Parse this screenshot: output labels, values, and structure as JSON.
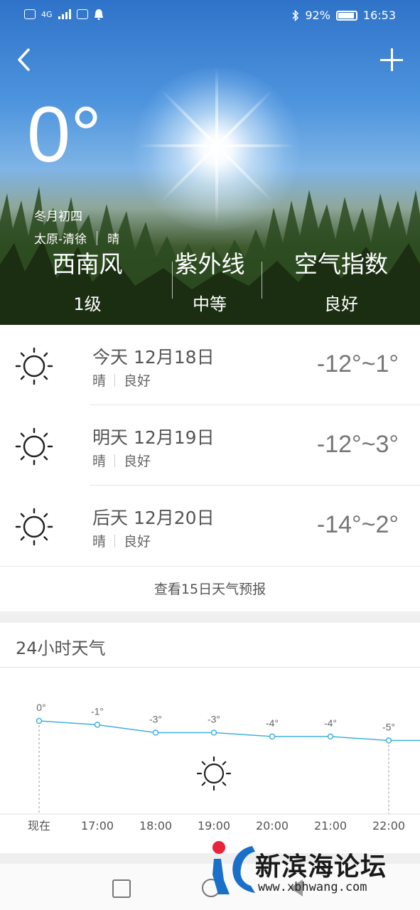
{
  "status_bar": {
    "left_icons": [
      "hd-icon",
      "signal-icon",
      "wifi-calling-icon",
      "notification-icon"
    ],
    "network": "4G",
    "battery": "92%",
    "time": "16:53"
  },
  "header": {
    "back_icon": "chevron-left-icon",
    "add_icon": "plus-icon"
  },
  "current": {
    "temperature": "0°",
    "lunar_date": "冬月初四",
    "location": "太原-清徐",
    "condition": "晴"
  },
  "stats": [
    {
      "title": "西南风",
      "value": "1级"
    },
    {
      "title": "紫外线",
      "value": "中等"
    },
    {
      "title": "空气指数",
      "value": "良好"
    }
  ],
  "forecast": [
    {
      "date": "今天 12月18日",
      "weather": "晴",
      "air": "良好",
      "range": "-12°~1°",
      "icon": "sun-icon"
    },
    {
      "date": "明天 12月19日",
      "weather": "晴",
      "air": "良好",
      "range": "-12°~3°",
      "icon": "sun-icon"
    },
    {
      "date": "后天 12月20日",
      "weather": "晴",
      "air": "良好",
      "range": "-14°~2°",
      "icon": "sun-icon"
    }
  ],
  "more_link": "查看15日天气预报",
  "hourly": {
    "title": "24小时天气",
    "icon": "sun-icon"
  },
  "chart_data": {
    "type": "line",
    "categories": [
      "现在",
      "17:00",
      "18:00",
      "19:00",
      "20:00",
      "21:00",
      "22:00"
    ],
    "values": [
      0,
      -1,
      -3,
      -3,
      -4,
      -4,
      -5
    ],
    "labels": [
      "0°",
      "-1°",
      "-3°",
      "-3°",
      "-4°",
      "-4°",
      "-5°"
    ],
    "line_color": "#3fb0e0",
    "title": "",
    "xlabel": "",
    "ylabel": ""
  },
  "navbar": {
    "icons": [
      "recents-icon",
      "home-icon",
      "back-icon"
    ]
  },
  "watermark": {
    "title": "新滨海论坛",
    "url": "www.xbhwang.com"
  }
}
